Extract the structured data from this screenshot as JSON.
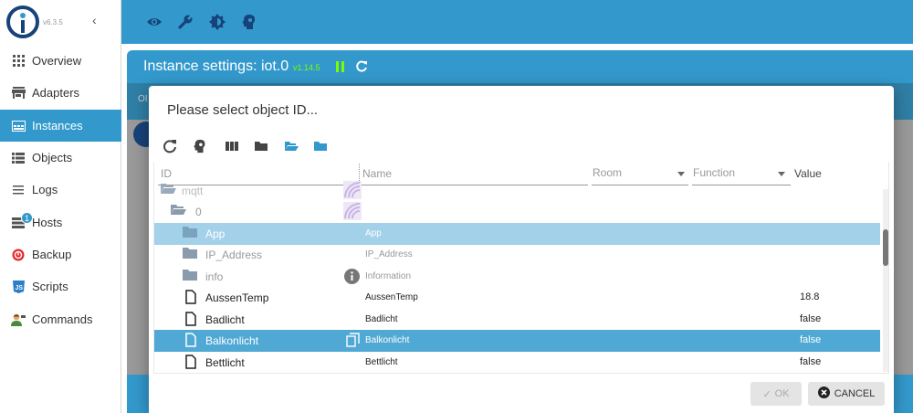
{
  "app": {
    "version": "v6.3.5"
  },
  "sidebar": {
    "items": [
      {
        "label": "Overview",
        "icon": "grid-icon"
      },
      {
        "label": "Adapters",
        "icon": "store-icon"
      },
      {
        "label": "Instances",
        "icon": "instances-icon",
        "active": true
      },
      {
        "label": "Objects",
        "icon": "list-icon"
      },
      {
        "label": "Logs",
        "icon": "menu-icon"
      },
      {
        "label": "Hosts",
        "icon": "hosts-icon",
        "badge": "1"
      },
      {
        "label": "Backup",
        "icon": "backup-icon"
      },
      {
        "label": "Scripts",
        "icon": "js-icon"
      },
      {
        "label": "Commands",
        "icon": "person-icon"
      }
    ]
  },
  "topbar": {
    "icons": [
      "eye-icon",
      "wrench-icon",
      "brightness-icon",
      "head-icon"
    ]
  },
  "instance": {
    "title": "Instance settings: iot.0",
    "version": "v1.14.5",
    "tab_hint": "OI"
  },
  "dialog": {
    "title": "Please select object ID...",
    "toolbar": [
      "refresh-icon",
      "head-icon",
      "columns-icon",
      "folder-icon",
      "folder-open-icon",
      "folder-icon"
    ],
    "columns": {
      "id": "ID",
      "name": "Name",
      "room": "Room",
      "function": "Function",
      "value": "Value"
    },
    "rows": [
      {
        "id": "mqtt",
        "name": "",
        "value": "",
        "type": "folder-open"
      },
      {
        "id": "0",
        "name": "",
        "value": "",
        "type": "folder-open"
      },
      {
        "id": "App",
        "name": "App",
        "value": "",
        "type": "folder"
      },
      {
        "id": "IP_Address",
        "name": "IP_Address",
        "value": "",
        "type": "folder"
      },
      {
        "id": "info",
        "name": "Information",
        "value": "",
        "type": "folder"
      },
      {
        "id": "AussenTemp",
        "name": "AussenTemp",
        "value": "18.8",
        "type": "file"
      },
      {
        "id": "Badlicht",
        "name": "Badlicht",
        "value": "false",
        "type": "file"
      },
      {
        "id": "Balkonlicht",
        "name": "Balkonlicht",
        "value": "false",
        "type": "file"
      },
      {
        "id": "Bettlicht",
        "name": "Bettlicht",
        "value": "false",
        "type": "file"
      }
    ],
    "ok_label": "OK",
    "cancel_label": "CANCEL"
  },
  "colors": {
    "accent": "#3399cc",
    "dark": "#17437a",
    "selected": "#50a8d4",
    "selected_light": "#a3d1ea"
  }
}
